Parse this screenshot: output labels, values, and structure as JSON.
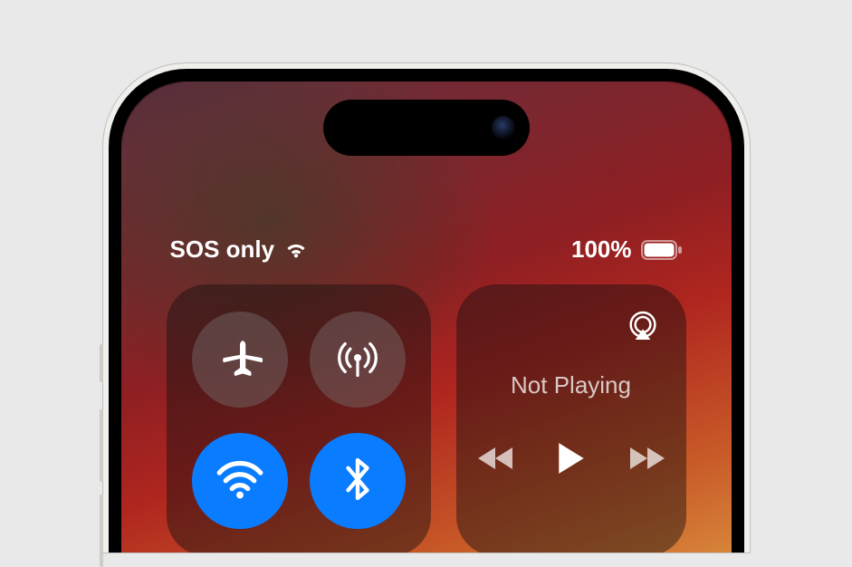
{
  "status_bar": {
    "carrier_text": "SOS only",
    "battery_percent_text": "100%",
    "battery_percent_value": 100
  },
  "connectivity": {
    "airplane": {
      "label": "Airplane Mode",
      "active": false
    },
    "cellular": {
      "label": "Cellular Data",
      "active": false
    },
    "wifi": {
      "label": "Wi-Fi",
      "active": true
    },
    "bluetooth": {
      "label": "Bluetooth",
      "active": true
    }
  },
  "media": {
    "now_playing_text": "Not Playing",
    "airplay_label": "AirPlay",
    "rewind_label": "Rewind",
    "play_label": "Play",
    "forward_label": "Forward"
  },
  "colors": {
    "active_toggle": "#0a7cff",
    "panel_bg": "rgba(20,15,15,0.45)"
  }
}
